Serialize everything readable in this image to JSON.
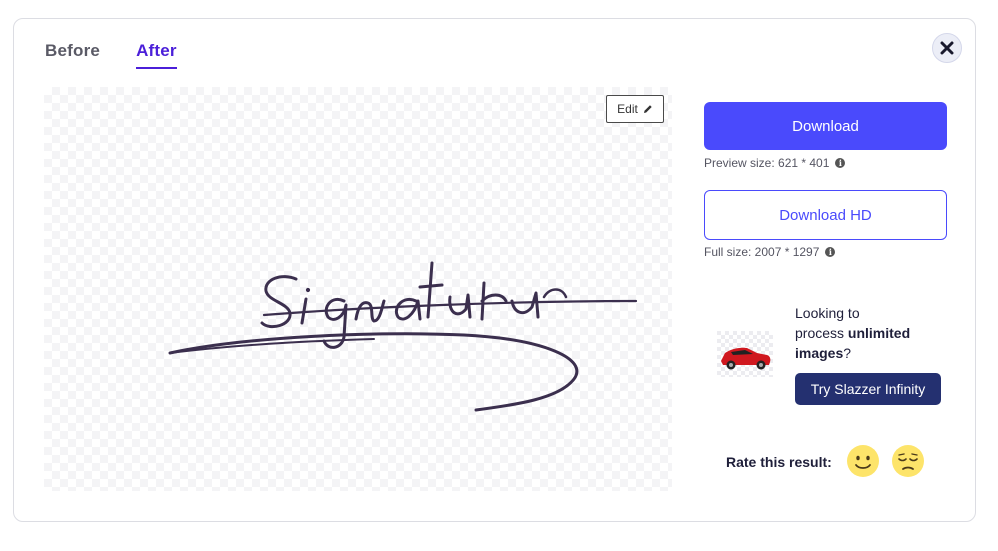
{
  "tabs": [
    {
      "label": "Before",
      "active": false
    },
    {
      "label": "After",
      "active": true
    }
  ],
  "close_icon": "close-icon",
  "preview": {
    "edit_label": "Edit",
    "edit_icon": "pencil-icon",
    "signature_text": "Signatur"
  },
  "download": {
    "label": "Download",
    "size_note": "Preview size: 621 * 401"
  },
  "download_hd": {
    "label": "Download HD",
    "size_note": "Full size: 2007 * 1297"
  },
  "promo": {
    "line1": "Looking to",
    "line2_prefix": "process ",
    "line2_bold": "unlimited",
    "line3_bold": "images",
    "line3_suffix": "?",
    "button_label": "Try Slazzer Infinity"
  },
  "rating": {
    "label": "Rate this result:",
    "icons": [
      "smile-emoji-icon",
      "pensive-emoji-icon"
    ]
  },
  "colors": {
    "accent": "#4a4afc",
    "tab_active": "#4b1fd9",
    "promo_button": "#243070",
    "emoji": "#fde46a"
  }
}
